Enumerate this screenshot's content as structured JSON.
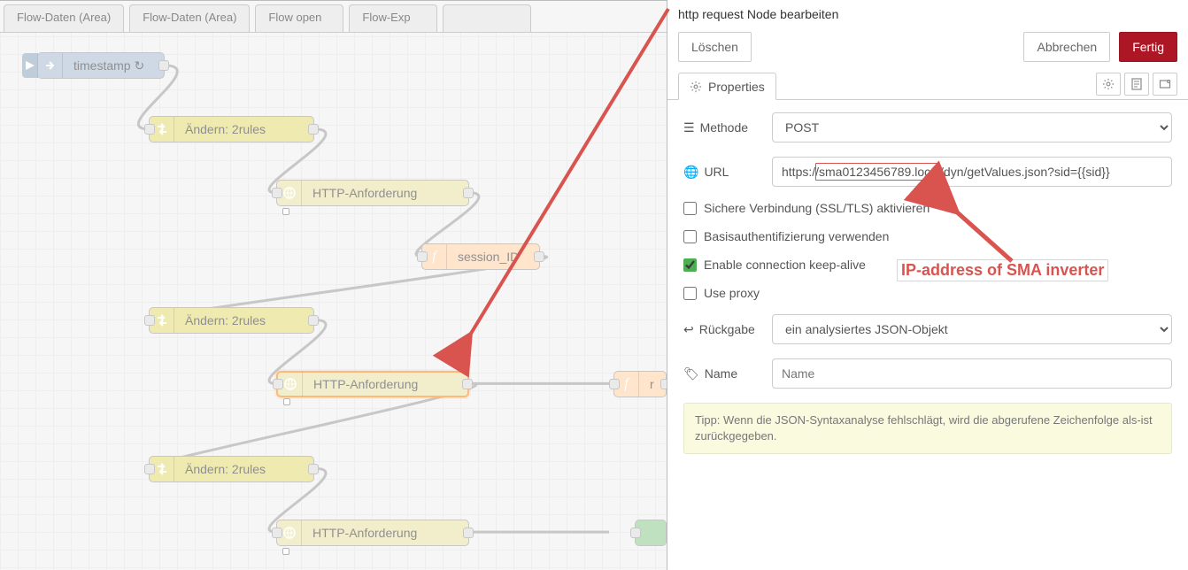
{
  "workspace": {
    "tabs": [
      "Flow-Daten (Area)",
      "Flow-Daten (Area)",
      "Flow open",
      "Flow-Exp",
      ""
    ],
    "nodes": {
      "inject": {
        "label": "timestamp ↻"
      },
      "change1": {
        "label": "Ändern: 2rules"
      },
      "http1": {
        "label": "HTTP-Anforderung"
      },
      "func1": {
        "label": "session_ID"
      },
      "change2": {
        "label": "Ändern: 2rules"
      },
      "http2": {
        "label": "HTTP-Anforderung"
      },
      "func2": {
        "label": "r"
      },
      "change3": {
        "label": "Ändern: 2rules"
      },
      "http3": {
        "label": "HTTP-Anforderung"
      },
      "func3": {
        "label": ""
      }
    }
  },
  "panel": {
    "title": "http request Node bearbeiten",
    "buttons": {
      "delete": "Löschen",
      "cancel": "Abbrechen",
      "done": "Fertig"
    },
    "tabs": {
      "properties": "Properties"
    },
    "form": {
      "method": {
        "label": "Methode",
        "value": "POST"
      },
      "url": {
        "label": "URL",
        "value": "https://sma0123456789.local/dyn/getValues.json?sid={{sid}}",
        "highlight": "sma0123456789.local"
      },
      "ssl": {
        "label": "Sichere Verbindung (SSL/TLS) aktivieren",
        "checked": false
      },
      "basic": {
        "label": "Basisauthentifizierung verwenden",
        "checked": false
      },
      "keepalive": {
        "label": "Enable connection keep-alive",
        "checked": true
      },
      "proxy": {
        "label": "Use proxy",
        "checked": false
      },
      "return": {
        "label": "Rückgabe",
        "value": "ein analysiertes JSON-Objekt"
      },
      "name": {
        "label": "Name",
        "placeholder": "Name",
        "value": ""
      }
    },
    "hint": "Tipp: Wenn die JSON-Syntaxanalyse fehlschlägt, wird die abgerufene Zeichenfolge als-ist zurückgegeben."
  },
  "annotation": {
    "label": "IP-address of SMA inverter"
  }
}
